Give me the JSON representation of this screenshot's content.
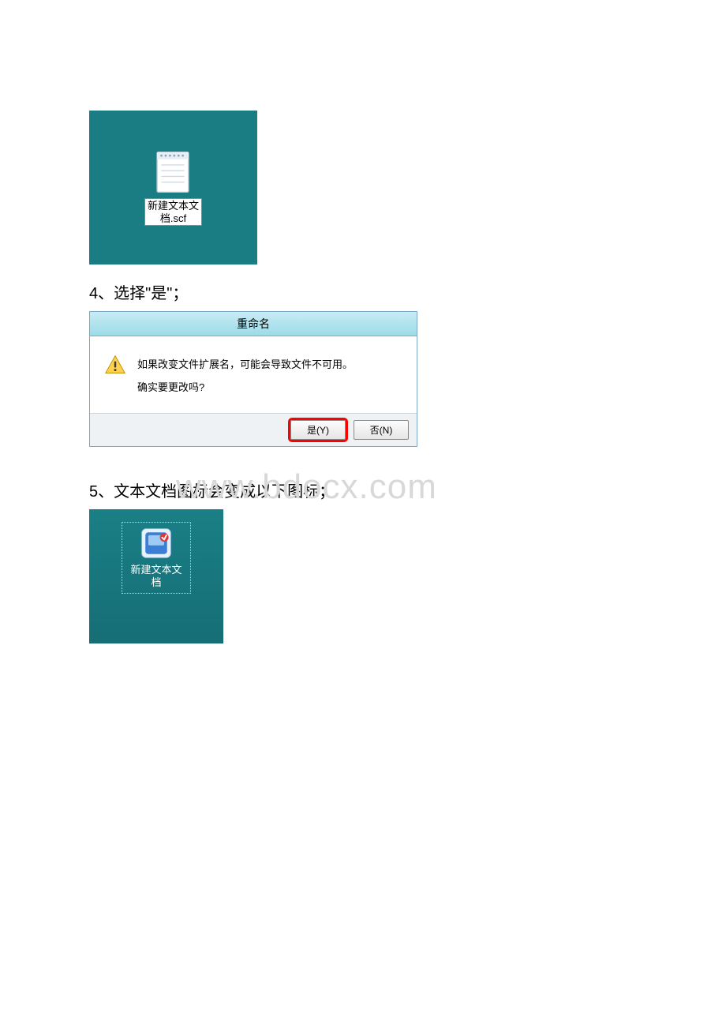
{
  "figure1": {
    "file_label_line1": "新建文本文",
    "file_label_line2": "档.scf"
  },
  "step4": {
    "text": "4、选择\"是\"；"
  },
  "dialog": {
    "title": "重命名",
    "line1": "如果改变文件扩展名，可能会导致文件不可用。",
    "line2": "确实要更改吗?",
    "yes_label": "是(Y)",
    "no_label": "否(N)"
  },
  "step5": {
    "text": "5、文本文档图标会变成以下图标；"
  },
  "watermark": {
    "text": "www.bdocx.com"
  },
  "figure3": {
    "file_label_line1": "新建文本文",
    "file_label_line2": "档"
  }
}
